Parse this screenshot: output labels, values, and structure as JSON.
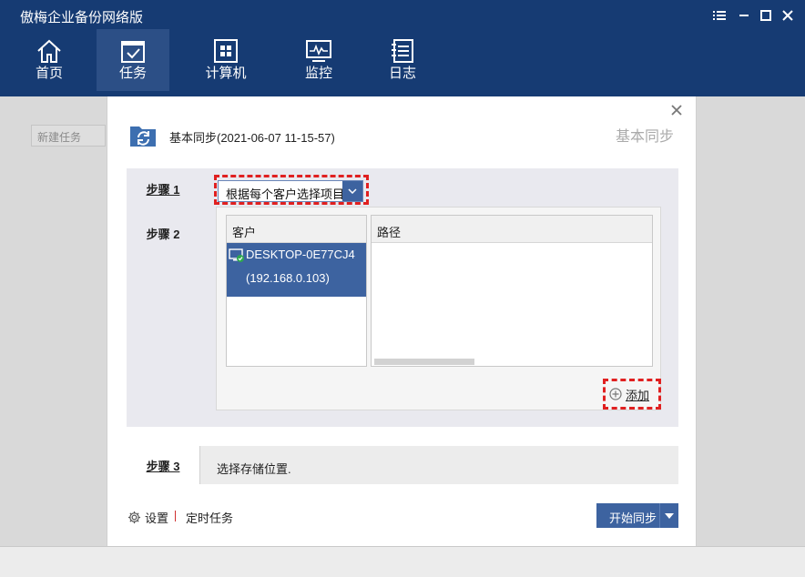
{
  "app": {
    "title": "傲梅企业备份网络版"
  },
  "window_controls": {
    "menu": "menu-icon",
    "minimize": "minimize-icon",
    "maximize": "maximize-icon",
    "close": "close-icon"
  },
  "nav": [
    {
      "label": "首页",
      "icon": "home-icon"
    },
    {
      "label": "任务",
      "icon": "task-icon",
      "active": true
    },
    {
      "label": "计算机",
      "icon": "computer-icon"
    },
    {
      "label": "监控",
      "icon": "monitor-icon"
    },
    {
      "label": "日志",
      "icon": "log-icon"
    }
  ],
  "background": {
    "new_task_label": "新建任务"
  },
  "dialog": {
    "task_name": "基本同步(2021-06-07 11-15-57)",
    "watermark": "基本同步",
    "step1": {
      "label": "步骤 1",
      "dropdown_value": "根据每个客户选择项目"
    },
    "step2": {
      "label": "步骤 2",
      "client_header": "客户",
      "path_header": "路径",
      "clients": [
        {
          "name": "DESKTOP-0E77CJ4",
          "ip": "(192.168.0.103)"
        }
      ],
      "add_label": "添加"
    },
    "step3": {
      "label": "步骤 3",
      "text": "选择存储位置."
    },
    "footer": {
      "settings_label": "设置",
      "schedule_label": "定时任务",
      "start_label": "开始同步"
    }
  },
  "colors": {
    "topbar": "#163b73",
    "accent": "#3d63a0",
    "highlight": "#e02020"
  }
}
